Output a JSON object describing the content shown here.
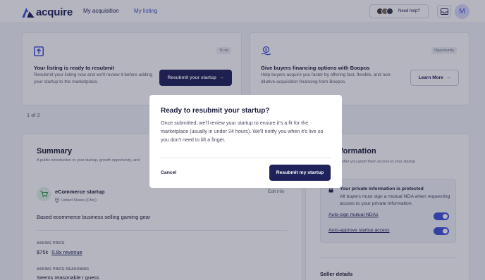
{
  "header": {
    "logo_text": "acquire",
    "nav": [
      "My acquisition",
      "My listing"
    ],
    "help_label": "Need help?",
    "user_initial": "M"
  },
  "resubmit_card": {
    "tag": "To do",
    "title": "Your listing is ready to resubmit",
    "desc": "Resubmit your listing now and we'll review it before adding your startup to the marketplace.",
    "button": "Resubmit your startup"
  },
  "financing_card": {
    "tag": "Opportunity",
    "title": "Give buyers financing options with Boopos",
    "desc": "Help buyers acquire you faster by offering fast, flexible, and non-dilutive acquisition financing from Boopos.",
    "button": "Learn More"
  },
  "pager": "1 of 2",
  "summary": {
    "title": "Summary",
    "subtitle": "A public introduction to your startup, growth opportunity, and",
    "startup_name": "eCommerce startup",
    "location": "United States (Ohio)",
    "edit_label": "Edit info",
    "description": "Based ecommerce business selling gaming gear",
    "asking_price_label": "ASKING PRICE",
    "asking_price": "$75k",
    "revenue_multiple": "0.8x revenue",
    "reasoning_label": "ASKING PRICE REASONING",
    "reasoning": "Seems reasonable I guess"
  },
  "private_info": {
    "title": "e information",
    "subtitle": "see this after you grant them access to your startup",
    "protected_title": "Your private information is protected",
    "protected_desc": "All buyers must sign a mutual NDA when requesting access to your private information.",
    "nda_label": "Auto-sign mutual NDAs",
    "access_label": "Auto-approve startup access",
    "nda_on": true,
    "access_on": true,
    "seller_details": "Seller details"
  },
  "modal": {
    "title": "Ready to resubmit your startup?",
    "body": "Once submitted, we'll review your startup to ensure it's a fit for the marketplace (usually in under 24 hours). We'll notify you when it's live so you don't need to lift a finger.",
    "cancel": "Cancel",
    "confirm": "Resubmit my startup"
  },
  "colors": {
    "brand": "#20235b",
    "accent": "#3f51d8",
    "background": "#f4f5fb"
  }
}
